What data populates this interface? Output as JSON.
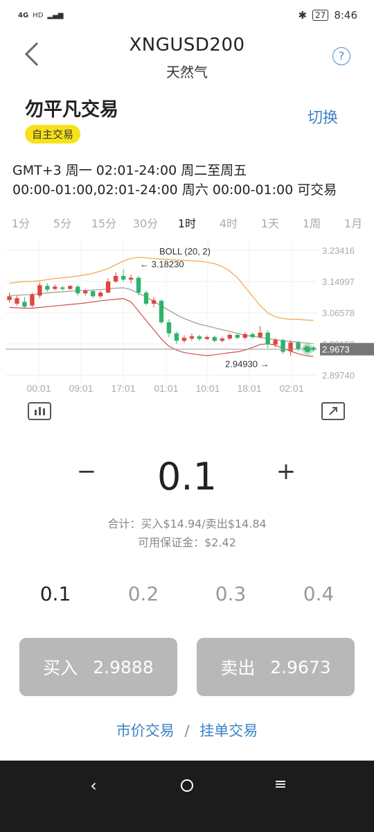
{
  "status_bar": {
    "network": "4G",
    "hd": "HD",
    "battery": "27",
    "time": "8:46"
  },
  "header": {
    "symbol": "XNGUSD200",
    "name": "天然气",
    "help": "?"
  },
  "mode": {
    "title": "勿平凡交易",
    "switch": "切换",
    "badge": "自主交易"
  },
  "trading_hours": {
    "line1": "GMT+3 周一 02:01-24:00  周二至周五",
    "line2": "00:00-01:00,02:01-24:00  周六 00:00-01:00 可交易"
  },
  "timeframes": [
    "1分",
    "5分",
    "15分",
    "30分",
    "1时",
    "4时",
    "1天",
    "1周",
    "1月"
  ],
  "active_timeframe": "1时",
  "chart_data": {
    "type": "candlestick",
    "indicator": "BOLL (20, 2)",
    "high_marker": "← 3.18230",
    "low_marker": "2.94930 →",
    "current_price": "2.9673",
    "y_ticks": [
      "3.23416",
      "3.14997",
      "3.06578",
      "2.98159",
      "2.89740"
    ],
    "x_ticks": [
      "00:01",
      "09:01",
      "17:01",
      "01:01",
      "10:01",
      "18:01",
      "02:01"
    ],
    "ylim": [
      2.8974,
      3.23416
    ],
    "candles": [
      [
        3.11,
        3.1,
        3.12,
        3.092,
        "up"
      ],
      [
        3.105,
        3.09,
        3.112,
        3.085,
        "up"
      ],
      [
        3.095,
        3.082,
        3.108,
        3.078,
        "down"
      ],
      [
        3.085,
        3.115,
        3.12,
        3.08,
        "up"
      ],
      [
        3.112,
        3.14,
        3.148,
        3.105,
        "up"
      ],
      [
        3.138,
        3.128,
        3.145,
        3.122,
        "down"
      ],
      [
        3.13,
        3.136,
        3.142,
        3.126,
        "up"
      ],
      [
        3.134,
        3.13,
        3.138,
        3.125,
        "down"
      ],
      [
        3.13,
        3.138,
        3.14,
        3.128,
        "up"
      ],
      [
        3.136,
        3.118,
        3.14,
        3.112,
        "down"
      ],
      [
        3.118,
        3.125,
        3.13,
        3.112,
        "up"
      ],
      [
        3.124,
        3.11,
        3.128,
        3.106,
        "down"
      ],
      [
        3.11,
        3.12,
        3.125,
        3.105,
        "up"
      ],
      [
        3.12,
        3.15,
        3.158,
        3.118,
        "up"
      ],
      [
        3.15,
        3.165,
        3.175,
        3.146,
        "up"
      ],
      [
        3.165,
        3.155,
        3.182,
        3.15,
        "down"
      ],
      [
        3.155,
        3.16,
        3.168,
        3.145,
        "up"
      ],
      [
        3.16,
        3.12,
        3.165,
        3.112,
        "down"
      ],
      [
        3.12,
        3.09,
        3.125,
        3.085,
        "down"
      ],
      [
        3.09,
        3.1,
        3.108,
        3.08,
        "up"
      ],
      [
        3.098,
        3.04,
        3.102,
        3.035,
        "down"
      ],
      [
        3.04,
        3.01,
        3.048,
        3.0,
        "down"
      ],
      [
        3.01,
        2.99,
        3.015,
        2.982,
        "down"
      ],
      [
        2.99,
        2.998,
        3.005,
        2.984,
        "up"
      ],
      [
        2.996,
        3.002,
        3.01,
        2.99,
        "up"
      ],
      [
        3.002,
        2.995,
        3.006,
        2.99,
        "down"
      ],
      [
        2.995,
        3.0,
        3.004,
        2.992,
        "up"
      ],
      [
        3.0,
        2.99,
        3.004,
        2.986,
        "down"
      ],
      [
        2.99,
        2.996,
        3.0,
        2.986,
        "up"
      ],
      [
        2.996,
        3.006,
        3.01,
        2.992,
        "up"
      ],
      [
        3.006,
        2.998,
        3.01,
        2.994,
        "down"
      ],
      [
        2.998,
        3.008,
        3.014,
        2.994,
        "up"
      ],
      [
        3.008,
        3.0,
        3.012,
        2.996,
        "down"
      ],
      [
        3.0,
        3.012,
        3.03,
        2.996,
        "up"
      ],
      [
        3.012,
        2.98,
        3.018,
        2.97,
        "down"
      ],
      [
        2.98,
        2.992,
        2.998,
        2.972,
        "up"
      ],
      [
        2.992,
        2.96,
        2.996,
        2.955,
        "down"
      ],
      [
        2.962,
        2.985,
        2.992,
        2.95,
        "up"
      ],
      [
        2.985,
        2.968,
        2.99,
        2.962,
        "down"
      ],
      [
        2.968,
        2.972,
        2.978,
        2.962,
        "up"
      ],
      [
        2.972,
        2.965,
        2.976,
        2.96,
        "down"
      ]
    ],
    "boll_upper": [
      3.145,
      3.148,
      3.15,
      3.15,
      3.152,
      3.155,
      3.158,
      3.16,
      3.162,
      3.165,
      3.168,
      3.172,
      3.178,
      3.185,
      3.195,
      3.205,
      3.212,
      3.215,
      3.214,
      3.212,
      3.21,
      3.209,
      3.208,
      3.207,
      3.206,
      3.205,
      3.202,
      3.198,
      3.19,
      3.178,
      3.16,
      3.135,
      3.11,
      3.085,
      3.065,
      3.055,
      3.05,
      3.048,
      3.048,
      3.046,
      3.045
    ],
    "boll_mid": [
      3.112,
      3.113,
      3.114,
      3.115,
      3.117,
      3.119,
      3.121,
      3.122,
      3.124,
      3.125,
      3.126,
      3.127,
      3.128,
      3.13,
      3.132,
      3.133,
      3.128,
      3.118,
      3.108,
      3.096,
      3.084,
      3.072,
      3.06,
      3.05,
      3.042,
      3.035,
      3.03,
      3.025,
      3.02,
      3.015,
      3.01,
      3.005,
      3.002,
      2.999,
      2.996,
      2.993,
      2.99,
      2.988,
      2.986,
      2.984,
      2.982
    ],
    "boll_lower": [
      3.08,
      3.079,
      3.078,
      3.078,
      3.08,
      3.082,
      3.084,
      3.086,
      3.088,
      3.09,
      3.092,
      3.095,
      3.098,
      3.1,
      3.102,
      3.104,
      3.095,
      3.07,
      3.045,
      3.02,
      2.995,
      2.975,
      2.965,
      2.958,
      2.955,
      2.952,
      2.95,
      2.952,
      2.955,
      2.958,
      2.96,
      2.965,
      2.972,
      2.98,
      2.982,
      2.978,
      2.97,
      2.962,
      2.955,
      2.95,
      2.948
    ]
  },
  "quantity": {
    "minus": "−",
    "value": "0.1",
    "plus": "+"
  },
  "summary": {
    "line1": "合计：买入$14.94/卖出$14.84",
    "line2": "可用保证金：$2.42"
  },
  "presets": [
    "0.1",
    "0.2",
    "0.3",
    "0.4"
  ],
  "buy": {
    "label": "买入",
    "price": "2.9888"
  },
  "sell": {
    "label": "卖出",
    "price": "2.9673"
  },
  "order_types": {
    "market": "市价交易",
    "separator": "/",
    "limit": "挂单交易"
  },
  "navbar": {
    "back": "‹",
    "menu": "≡"
  },
  "colors": {
    "up": "#e0463c",
    "down": "#2fb36a",
    "boll_upper": "#f0a34a",
    "boll_mid": "#999999",
    "boll_lower": "#d24b4b",
    "accent": "#3b82c4",
    "badge": "#f7e21a"
  }
}
